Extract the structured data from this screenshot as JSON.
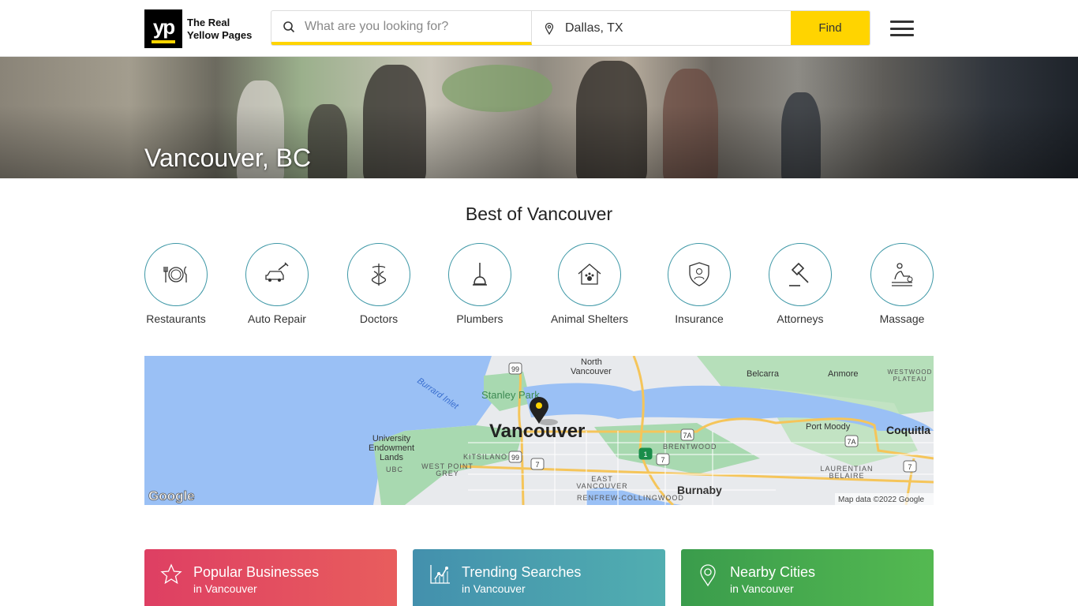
{
  "header": {
    "logo_mark": "yp",
    "logo_text_line1": "The Real",
    "logo_text_line2": "Yellow Pages",
    "search_placeholder": "What are you looking for?",
    "search_value": "",
    "location_value": "Dallas, TX",
    "find_label": "Find"
  },
  "hero": {
    "title": "Vancouver, BC"
  },
  "best": {
    "title": "Best of Vancouver",
    "categories": [
      {
        "label": "Restaurants",
        "icon": "plate-fork-knife-icon"
      },
      {
        "label": "Auto Repair",
        "icon": "car-wrench-icon"
      },
      {
        "label": "Doctors",
        "icon": "caduceus-icon"
      },
      {
        "label": "Plumbers",
        "icon": "plunger-icon"
      },
      {
        "label": "Animal Shelters",
        "icon": "paw-house-icon"
      },
      {
        "label": "Insurance",
        "icon": "shield-person-icon"
      },
      {
        "label": "Attorneys",
        "icon": "gavel-icon"
      },
      {
        "label": "Massage",
        "icon": "massage-icon"
      }
    ]
  },
  "map": {
    "labels": {
      "north_vancouver": [
        "North",
        "Vancouver"
      ],
      "stanley_park": "Stanley Park",
      "burrard_inlet": "Burrard Inlet",
      "vancouver": "Vancouver",
      "ueland": [
        "University",
        "Endowment",
        "Lands"
      ],
      "ubc": "UBC",
      "kitsilano": "KITSILANO",
      "west_point_grey": [
        "WEST POINT",
        "GREY"
      ],
      "belcarra": "Belcarra",
      "anmore": "Anmore",
      "westwood": [
        "WESTWOOD",
        "PLATEAU"
      ],
      "port_moody": "Port Moody",
      "coquitlam": "Coquitla",
      "brentwood": "BRENTWOOD",
      "east_vancouver": [
        "EAST",
        "VANCOUVER"
      ],
      "renfrew": "RENFREW-COLLINGWOOD",
      "burnaby": "Burnaby",
      "laurentian": [
        "LAURENTIAN",
        "BELAIRE"
      ]
    },
    "shields": [
      "99",
      "99",
      "7",
      "7A",
      "7",
      "1",
      "7A",
      "7"
    ],
    "google_logo": "Google",
    "attribution": "Map data ©2022 Google"
  },
  "cards": [
    {
      "title": "Popular Businesses",
      "subtitle": "in Vancouver",
      "icon": "star-icon",
      "color_from": "#de3f63",
      "color_to": "#e85d5d"
    },
    {
      "title": "Trending Searches",
      "subtitle": "in Vancouver",
      "icon": "trend-chart-icon",
      "color_from": "#4390ad",
      "color_to": "#51aeb0"
    },
    {
      "title": "Nearby Cities",
      "subtitle": "in Vancouver",
      "icon": "map-pin-icon",
      "color_from": "#3a9c4c",
      "color_to": "#54b951"
    }
  ],
  "colors": {
    "brand_yellow": "#ffd400",
    "category_ring": "#3d97a6"
  }
}
